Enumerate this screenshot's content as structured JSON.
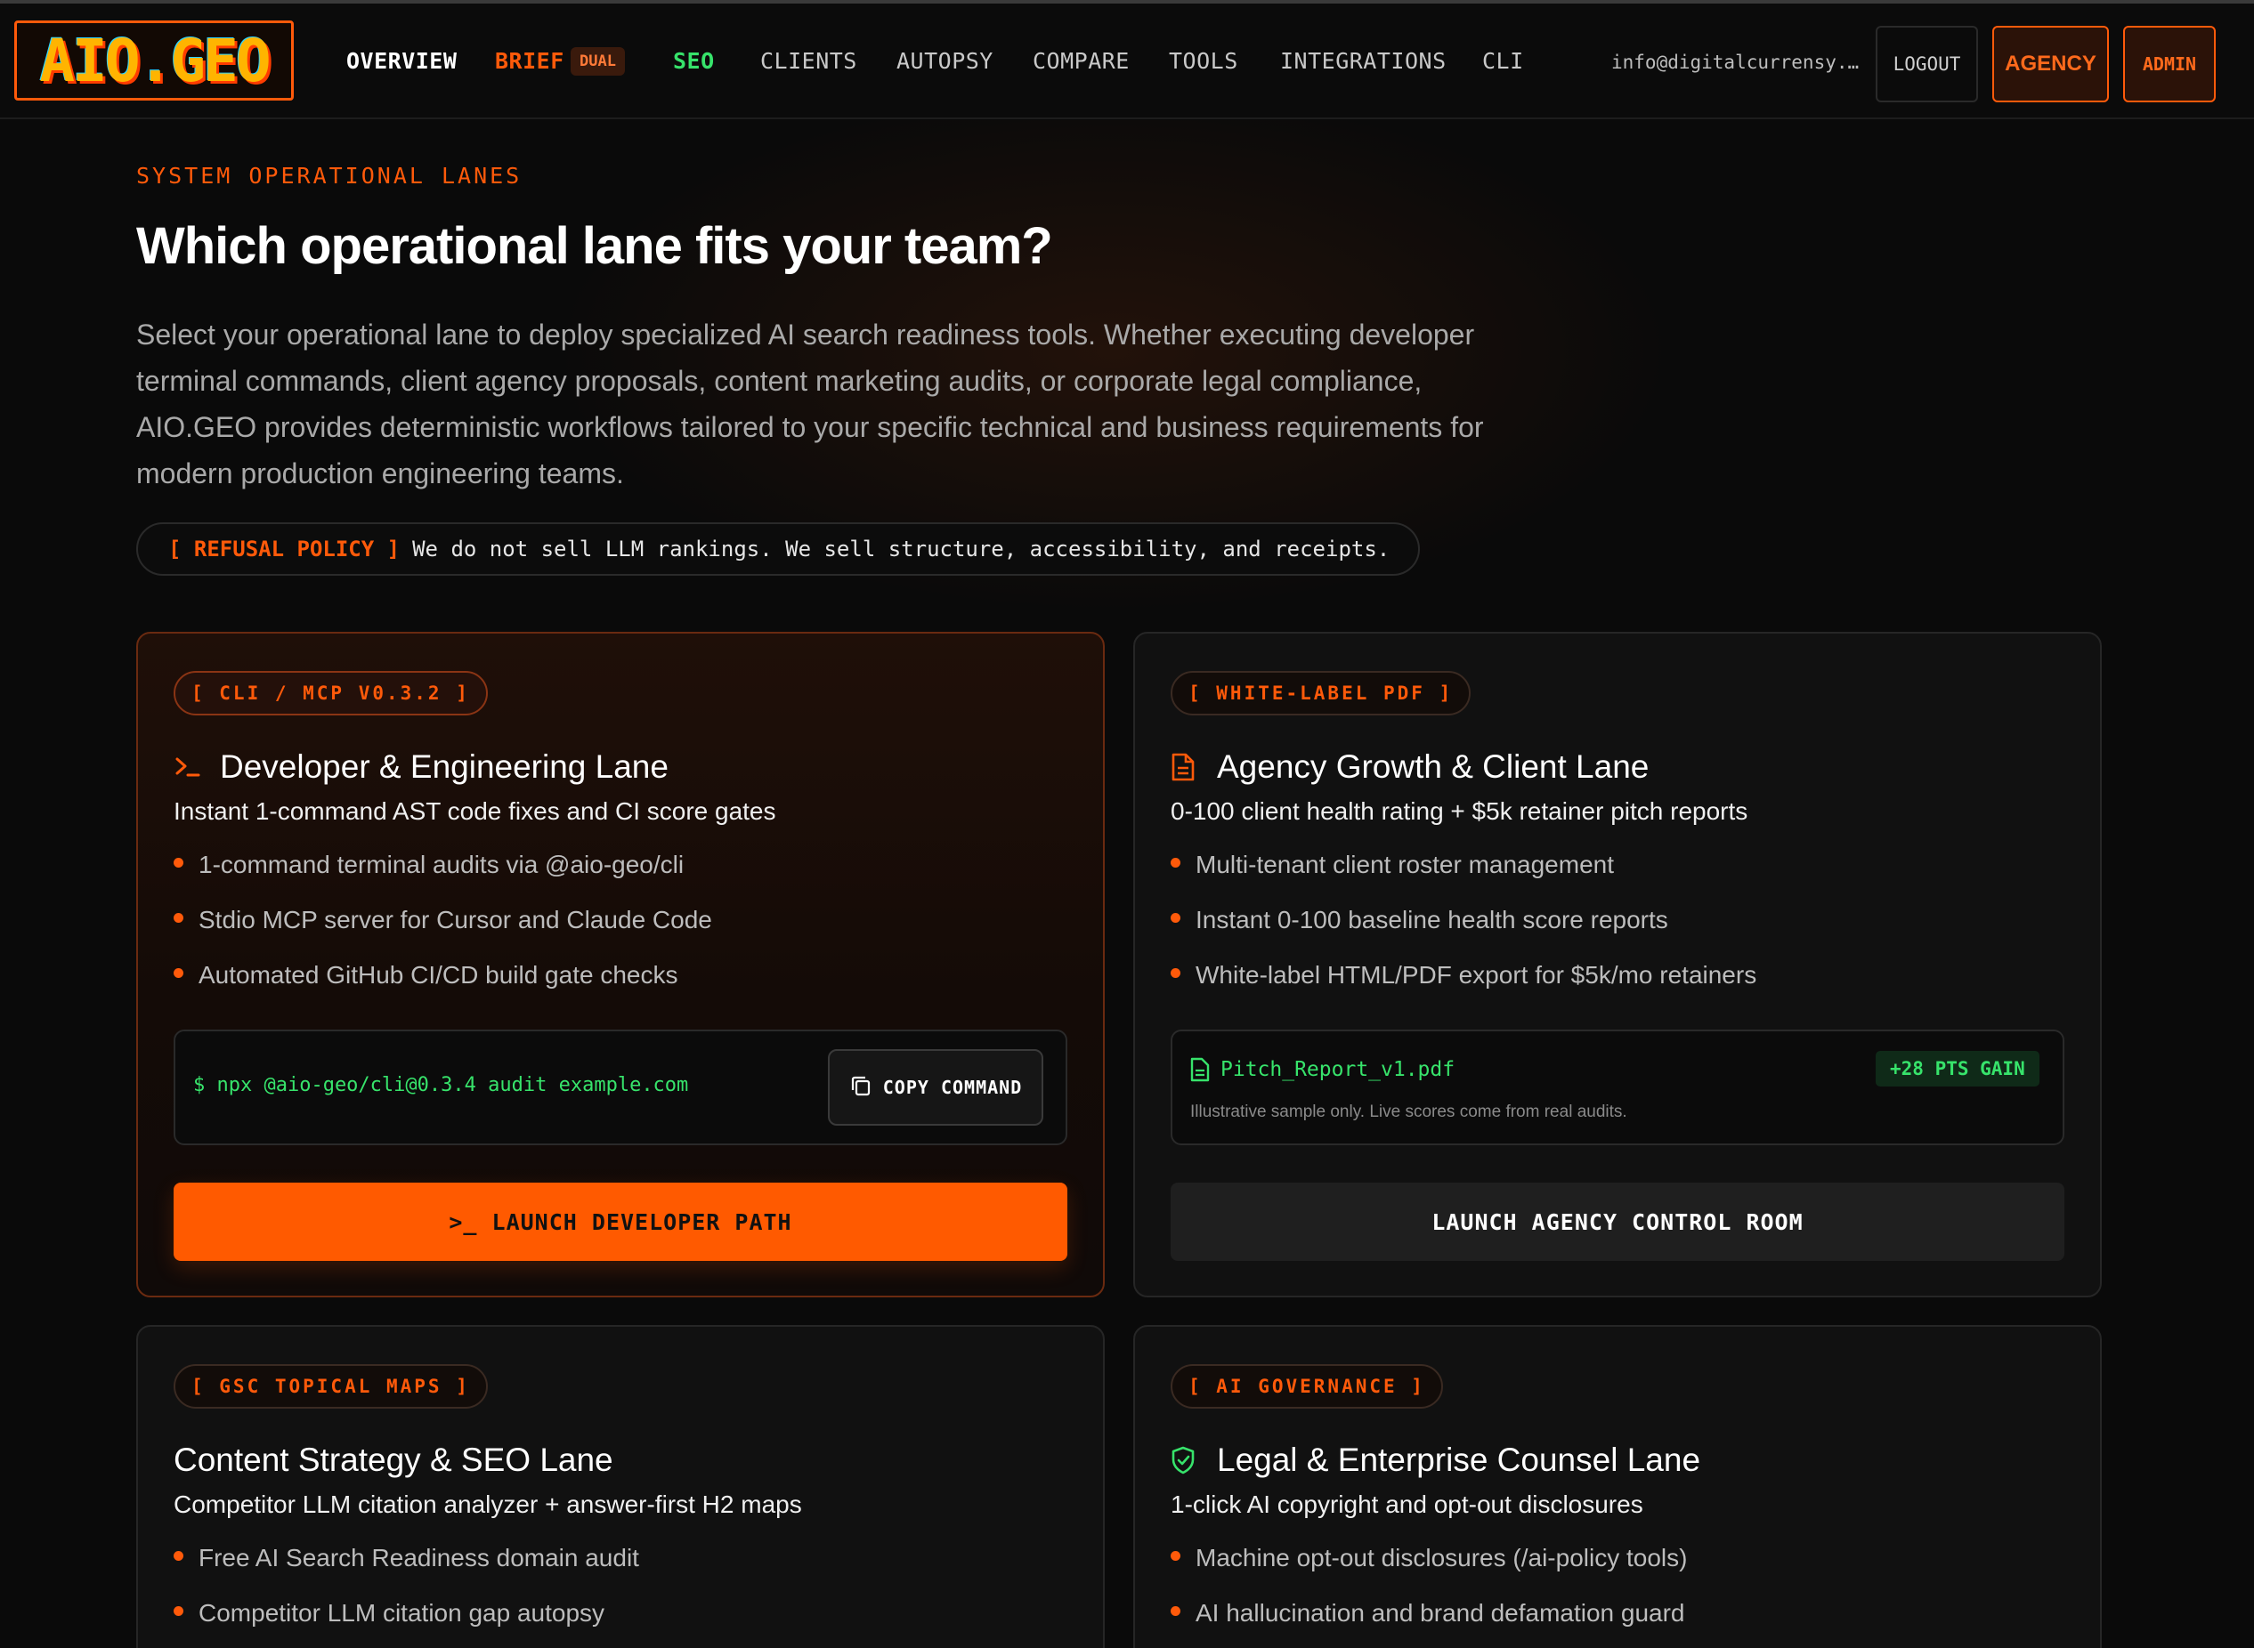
{
  "nav": {
    "logo": "AIO.GEO",
    "links": [
      "OVERVIEW",
      "BRIEF",
      "SEO",
      "CLIENTS",
      "AUTOPSY",
      "COMPARE",
      "TOOLS",
      "INTEGRATIONS",
      "CLI"
    ],
    "brief_badge": "DUAL",
    "email": "info@digitalcurrensy.c…",
    "logout": "LOGOUT",
    "agency": "AGENCY",
    "admin": "ADMIN"
  },
  "hero": {
    "eyebrow": "SYSTEM OPERATIONAL LANES",
    "title": "Which operational lane fits your team?",
    "description": "Select your operational lane to deploy specialized AI search readiness tools. Whether executing developer terminal commands, client agency proposals, content marketing audits, or corporate legal compliance, AIO.GEO provides deterministic workflows tailored to your specific technical and business requirements for modern production engineering teams.",
    "policy_tag": "[ REFUSAL POLICY ]",
    "policy_text": "We do not sell LLM rankings. We sell structure, accessibility, and receipts."
  },
  "cards": [
    {
      "tag": "[ CLI / MCP V0.3.2 ]",
      "icon": "terminal-prompt-icon",
      "title": "Developer & Engineering Lane",
      "subtitle": "Instant 1-command AST code fixes and CI score gates",
      "bullets": [
        "1-command terminal audits via @aio-geo/cli",
        "Stdio MCP server for Cursor and Claude Code",
        "Automated GitHub CI/CD build gate checks"
      ],
      "command": "$ npx @aio-geo/cli@0.3.4 audit example.com",
      "copy_label": "COPY COMMAND",
      "cta": ">_ LAUNCH DEVELOPER PATH"
    },
    {
      "tag": "[ WHITE-LABEL PDF ]",
      "icon": "document-icon",
      "title": "Agency Growth & Client Lane",
      "subtitle": "0-100 client health rating + $5k retainer pitch reports",
      "bullets": [
        "Multi-tenant client roster management",
        "Instant 0-100 baseline health score reports",
        "White-label HTML/PDF export for $5k/mo retainers"
      ],
      "file_name": "Pitch_Report_v1.pdf",
      "gain": "+28 PTS GAIN",
      "note": "Illustrative sample only. Live scores come from real audits.",
      "cta": "LAUNCH AGENCY CONTROL ROOM"
    },
    {
      "tag": "[ GSC TOPICAL MAPS ]",
      "title": "Content Strategy & SEO Lane",
      "subtitle": "Competitor LLM citation analyzer + answer-first H2 maps",
      "bullets": [
        "Free AI Search Readiness domain audit",
        "Competitor LLM citation gap autopsy"
      ]
    },
    {
      "tag": "[ AI GOVERNANCE ]",
      "icon": "shield-check-icon",
      "title": "Legal & Enterprise Counsel Lane",
      "subtitle": "1-click AI copyright and opt-out disclosures",
      "bullets": [
        "Machine opt-out disclosures (/ai-policy tools)",
        "AI hallucination and brand defamation guard"
      ]
    }
  ],
  "colors": {
    "accent": "#ff5a0a",
    "success": "#37e36b",
    "background": "#0a0a0a"
  }
}
